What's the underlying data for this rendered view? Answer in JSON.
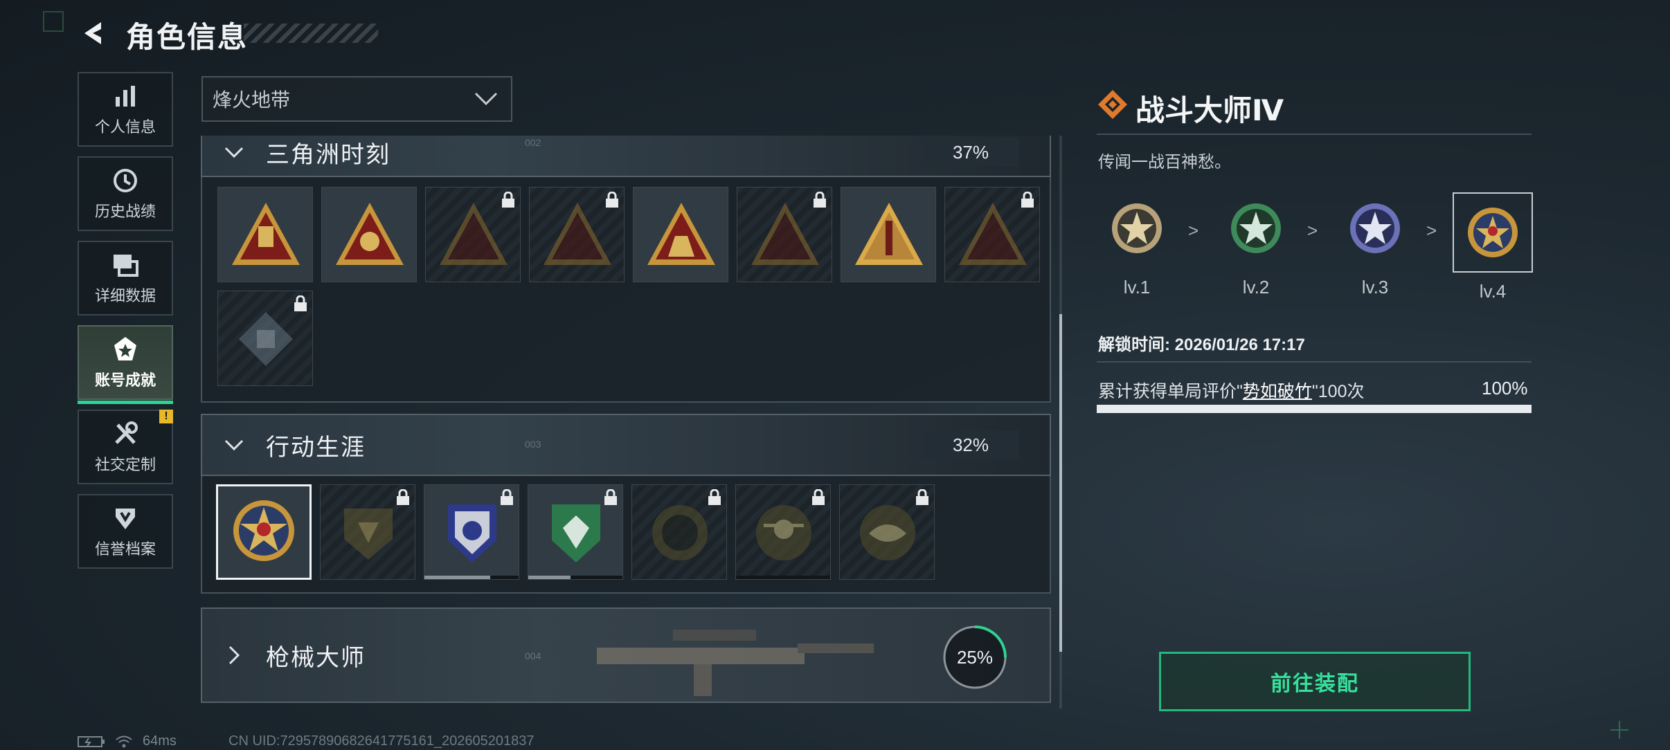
{
  "header": {
    "title": "角色信息"
  },
  "sidebar": {
    "items": [
      {
        "label": "个人信息",
        "icon": "bar-chart-icon"
      },
      {
        "label": "历史战绩",
        "icon": "history-clock-icon"
      },
      {
        "label": "详细数据",
        "icon": "data-cards-icon"
      },
      {
        "label": "账号成就",
        "icon": "achievement-icon",
        "active": true
      },
      {
        "label": "社交定制",
        "icon": "tools-icon",
        "badge": "!"
      },
      {
        "label": "信誉档案",
        "icon": "credit-shield-icon"
      }
    ]
  },
  "mode_select": {
    "value": "烽火地带"
  },
  "categories": [
    {
      "name": "三角洲时刻",
      "percent": "37%",
      "bg_text": "002",
      "expanded": true
    },
    {
      "name": "行动生涯",
      "percent": "32%",
      "bg_text": "003",
      "expanded": true
    },
    {
      "name": "枪械大师",
      "percent": "25%",
      "bg_text": "004",
      "expanded": false,
      "progress": 0.25
    }
  ],
  "detail": {
    "title": "战斗大师Ⅳ",
    "description": "传闻一战百神愁。",
    "levels": [
      {
        "label": "lv.1",
        "color": "#b7a27a"
      },
      {
        "label": "lv.2",
        "color": "#3e8a5a"
      },
      {
        "label": "lv.3",
        "color": "#6b72b8"
      },
      {
        "label": "lv.4",
        "color": "#c7953b",
        "current": true
      }
    ],
    "unlock_label": "解锁时间:",
    "unlock_time": "2026/01/26 17:17",
    "task_prefix": "累计获得单局评价\"",
    "task_highlight": "势如破竹",
    "task_suffix": "\"100次",
    "task_percent": "100%",
    "task_progress": 1.0
  },
  "equip_button": {
    "label": "前往装配"
  },
  "status": {
    "latency": "64ms",
    "uid": "CN UID:7295789068264177516​1_202605201837"
  },
  "colors": {
    "accent": "#2fd391",
    "badge_warn": "#e8b827"
  }
}
